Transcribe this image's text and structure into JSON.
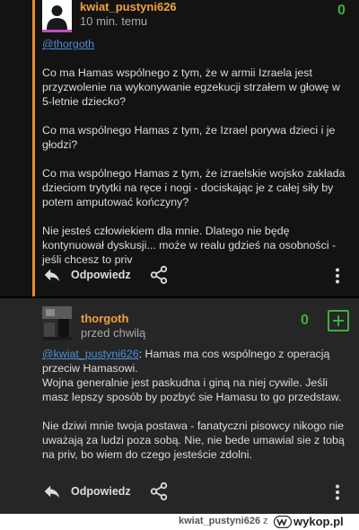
{
  "comment1": {
    "author": "kwiat_pustyni626",
    "time": "10 min. temu",
    "votes": "0",
    "mention": "@thorgoth",
    "paragraphs": [
      "Co ma Hamas wspólnego z tym, że w armii Izraela jest przyzwolenie na wykonywanie egzekucji strzałem w głowę w 5-letnie dziecko?",
      "Co ma wspólnego Hamas z tym, że Izrael porywa dzieci i je głodzi?",
      "Co ma wspólnego Hamas z tym, że izraelskie wojsko zakłada dzieciom trytytki na ręce i nogi - dociskając je z całej siły by potem amputować kończyny?",
      "Nie jesteś człowiekiem dla mnie. Dlatego nie będę kontynuował dyskusji... może w realu gdzieś na osobności - jeśli chcesz to priv"
    ],
    "reply_label": "Odpowiedz"
  },
  "comment2": {
    "author": "thorgoth",
    "time": "przed chwilą",
    "votes": "0",
    "mention": "@kwiat_pustyni626",
    "first_line_rest": ": Hamas ma cos wspólnego z operacją przeciw Hamasowi.",
    "paragraph1_rest": "Wojna generalnie jest paskudna i giną na niej cywile. Jeśli masz lepszy sposób by pozbyć sie Hamasu to go przedstaw.",
    "paragraph2": "Nie dziwi mnie twoja postawa - fanatyczni pisowcy nikogo nie uważają za ludzi poza sobą. Nie, nie bede umawial sie z tobą na priv, bo wiem do czego jesteście zdolni.",
    "reply_label": "Odpowiedz"
  },
  "footer": {
    "username": "kwiat_pustyni626",
    "connector": "z",
    "logo_text": "wykop.pl"
  },
  "colors": {
    "accent": "#e88a2e",
    "author": "#f0a040",
    "vote_green": "#3fae3f",
    "link": "#4d8fd8"
  }
}
